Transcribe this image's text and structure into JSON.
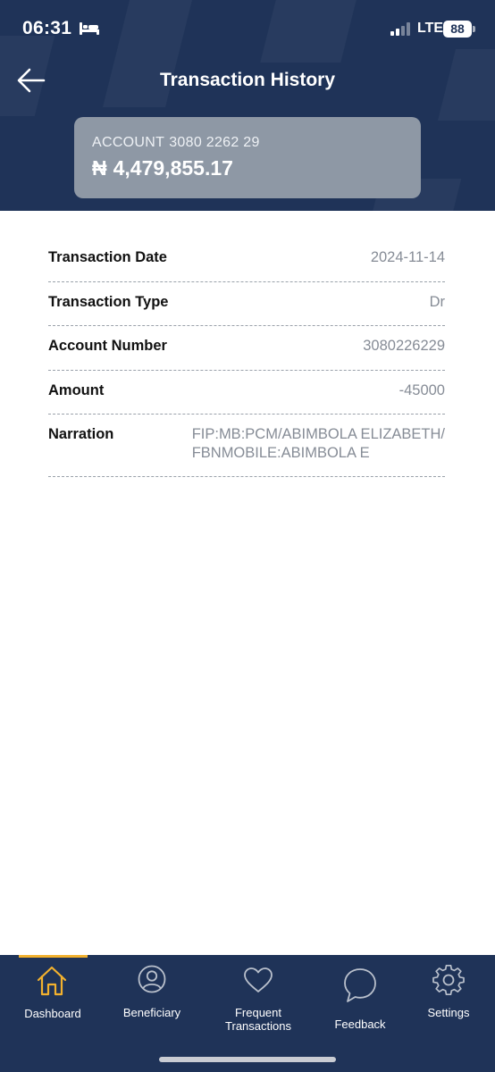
{
  "status_bar": {
    "time": "06:31",
    "network": "LTE",
    "battery": "88"
  },
  "header": {
    "title": "Transaction History",
    "back_icon": "arrow-left-icon"
  },
  "account": {
    "label": "ACCOUNT",
    "number": "3080 2262 29",
    "currency_symbol": "₦",
    "balance": "4,479,855.17"
  },
  "details": [
    {
      "label": "Transaction Date",
      "value": "2024-11-14"
    },
    {
      "label": "Transaction Type",
      "value": "Dr"
    },
    {
      "label": "Account Number",
      "value": "3080226229"
    },
    {
      "label": "Amount",
      "value": "-45000"
    },
    {
      "label": "Narration",
      "value_line1": "FIP:MB:PCM/ABIMBOLA ELIZABETH/",
      "value_line2": "FBNMOBILE:ABIMBOLA E"
    }
  ],
  "nav": {
    "dashboard": "Dashboard",
    "beneficiary": "Beneficiary",
    "frequent_line1": "Frequent",
    "frequent_line2": "Transactions",
    "feedback": "Feedback",
    "settings": "Settings"
  },
  "colors": {
    "header_bg": "#1f3358",
    "card_bg": "#8e98a5",
    "active_accent": "#f2b12e"
  }
}
